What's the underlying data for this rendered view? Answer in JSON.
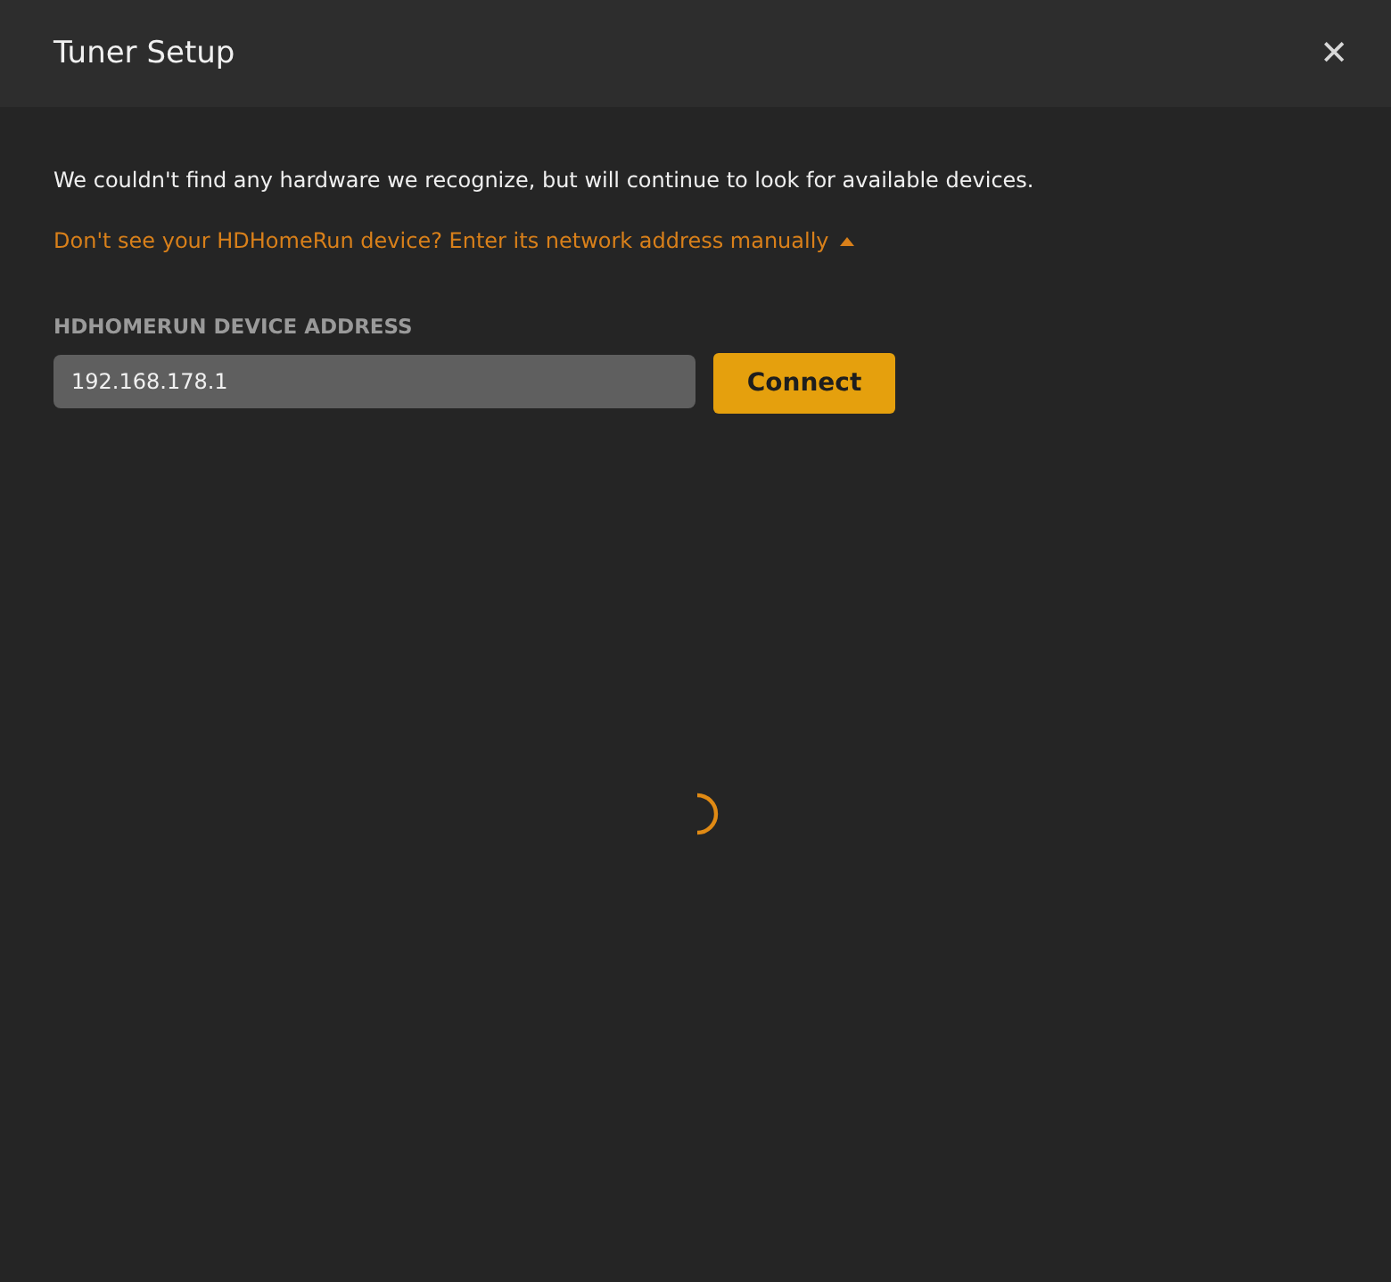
{
  "window": {
    "title": "Tuner Setup",
    "close": "✕"
  },
  "message": "We couldn't find any hardware we recognize, but will continue to look for available devices.",
  "manual_link": {
    "label": "Don't see your HDHomeRun device? Enter its network address manually",
    "expanded": true
  },
  "address_field": {
    "label": "HDHOMERUN DEVICE ADDRESS",
    "value": "192.168.178.1"
  },
  "buttons": [
    "Connect"
  ]
}
